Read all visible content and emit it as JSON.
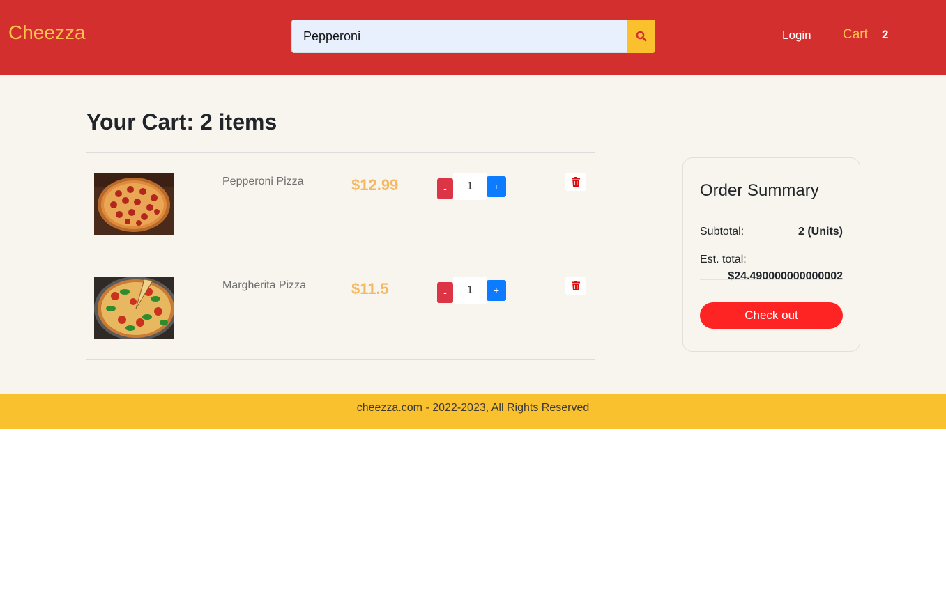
{
  "header": {
    "brand": "Cheezza",
    "search": {
      "value": "Pepperoni",
      "icon": "search-icon"
    },
    "login_label": "Login",
    "cart_label": "Cart",
    "cart_count": "2",
    "colors": {
      "header_bg": "#d32f2f",
      "brand": "#ffc14d",
      "search_button": "#fbc02d"
    }
  },
  "cart": {
    "title_prefix": "Your Cart:",
    "title_count": "2 items",
    "items": [
      {
        "name": "Pepperoni Pizza",
        "price": "$12.99",
        "quantity": "1",
        "minus_label": "-",
        "plus_label": "+",
        "image": "pepperoni-pizza-photo",
        "delete_icon": "trash-icon"
      },
      {
        "name": "Margherita Pizza",
        "price": "$11.5",
        "quantity": "1",
        "minus_label": "-",
        "plus_label": "+",
        "image": "margherita-pizza-photo",
        "delete_icon": "trash-icon"
      }
    ]
  },
  "summary": {
    "title": "Order Summary",
    "subtotal_label": "Subtotal:",
    "subtotal_value": "2 (Units)",
    "est_total_label": "Est. total:",
    "est_total_value": "$24.490000000000002",
    "checkout_label": "Check out",
    "colors": {
      "checkout": "#ff2424"
    }
  },
  "footer": {
    "text": "cheezza.com - 2022-2023, All Rights Reserved",
    "colors": {
      "footer_bg": "#fac12f"
    }
  }
}
